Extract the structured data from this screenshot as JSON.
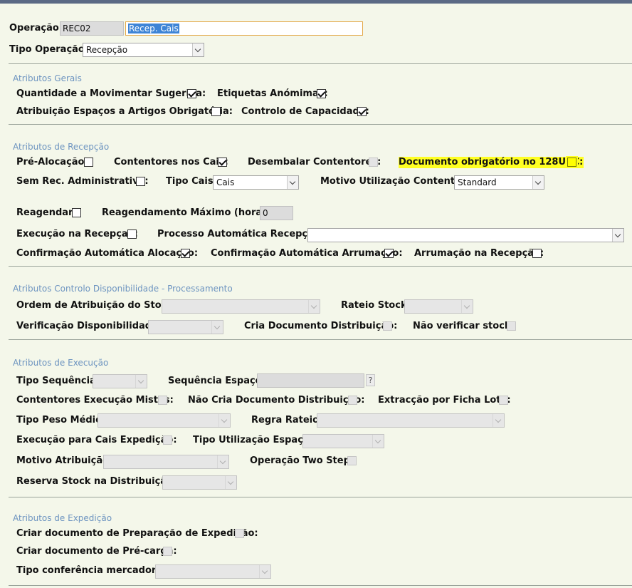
{
  "header": {
    "operacao_label": "Operação:",
    "operacao_code": "REC02",
    "operacao_desc": "Recep. Cais",
    "tipo_operacao_label": "Tipo Operação:",
    "tipo_operacao_value": "Recepção"
  },
  "gerais": {
    "title": "Atributos Gerais",
    "qtd_label": "Quantidade a Movimentar Sugerida:",
    "etiquetas_label": "Etiquetas Anómimas:",
    "atribuicao_label": "Atribuição Espaços a Artigos Obrigatória:",
    "controlo_label": "Controlo de Capacidade:"
  },
  "recepcao": {
    "title": "Atributos de Recepção",
    "pre_alocacao_label": "Pré-Alocação:",
    "contentores_cais_label": "Contentores nos Cais:",
    "desembalar_label": "Desembalar Contentores:",
    "documento_label": "Documento obrigatório no 128UCC:",
    "sem_rec_label": "Sem Rec. Administrativa:",
    "tipo_cais_label": "Tipo Cais:",
    "tipo_cais_value": "Cais",
    "motivo_label": "Motivo Utilização Contentor:",
    "motivo_value": "Standard",
    "reagendar_label": "Reagendar:",
    "reagendamento_label": "Reagendamento Máximo (horas):",
    "reagendamento_value": "0",
    "execucao_label": "Execução na Recepçao:",
    "processo_label": "Processo Automática Recepção:",
    "processo_value": "",
    "conf_alocacao_label": "Confirmação Automática Alocação:",
    "conf_arrumacao_label": "Confirmação Automática Arrumação:",
    "arrumacao_label": "Arrumação na Recepção:"
  },
  "disponibilidade": {
    "title": "Atributos Controlo Disponibilidade - Processamento",
    "ordem_label": "Ordem de Atribuição do Stock:",
    "rateio_label": "Rateio Stock:",
    "verificacao_label": "Verificação Disponibilidade:",
    "cria_doc_label": "Cria Documento Distribuição:",
    "nao_verificar_label": "Não verificar stock:"
  },
  "execucao": {
    "title": "Atributos de Execução",
    "tipo_sequencia_label": "Tipo Sequência:",
    "sequencia_espaco_label": "Sequência Espaço:",
    "help_label": "?",
    "contentores_mistos_label": "Contentores Execução Mistos:",
    "nao_cria_doc_label": "Não Cria Documento Distribuição:",
    "extraccao_label": "Extracção por Ficha Lote:",
    "tipo_peso_label": "Tipo Peso Médio:",
    "regra_rateio_label": "Regra Rateio:",
    "exec_cais_label": "Execução para Cais Expedição:",
    "tipo_utilizacao_label": "Tipo Utilização Espaço:",
    "motivo_atribuicao_label": "Motivo Atribuição:",
    "two_step_label": "Operação Two Step:",
    "reserva_label": "Reserva Stock na Distribuição:"
  },
  "expedicao": {
    "title": "Atributos de Expedição",
    "criar_prep_label": "Criar documento de Preparação de Expedição:",
    "criar_pre_carga_label": "Criar documento de Pré-carga:",
    "tipo_conferencia_label": "Tipo conferência mercadoria:"
  }
}
